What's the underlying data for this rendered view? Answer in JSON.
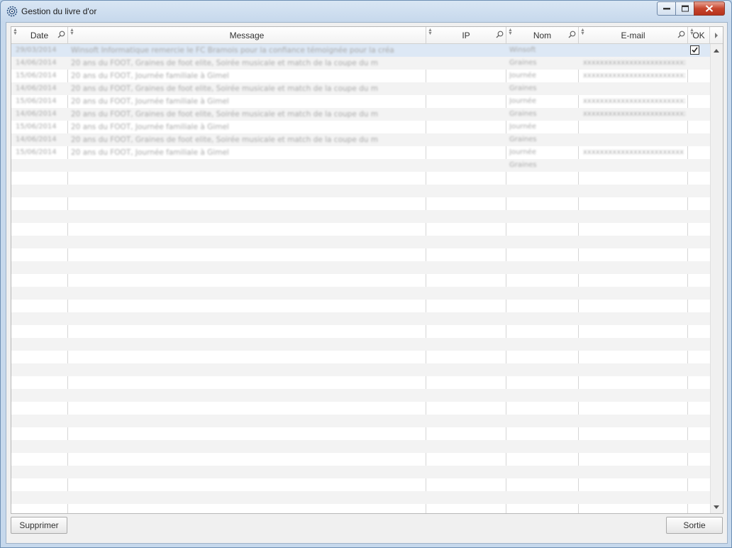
{
  "window": {
    "title": "Gestion du livre d'or",
    "icon": "gear-icon"
  },
  "grid": {
    "columns": [
      {
        "key": "date",
        "label": "Date",
        "icon": "search-icon"
      },
      {
        "key": "message",
        "label": "Message",
        "icon": null
      },
      {
        "key": "ip",
        "label": "IP",
        "icon": "search-icon"
      },
      {
        "key": "nom",
        "label": "Nom",
        "icon": "search-icon"
      },
      {
        "key": "email",
        "label": "E-mail",
        "icon": "search-icon"
      },
      {
        "key": "ok",
        "label": "OK",
        "icon": null
      }
    ],
    "rows": [
      {
        "date": "29/03/2014",
        "message": "Winsoft Informatique remercie le FC Bramois pour la confiance témoignée pour la créa",
        "ip": "",
        "nom": "Winsoft",
        "email": "",
        "ok": true,
        "selected": true
      },
      {
        "date": "14/06/2014",
        "message": "20 ans du FOOT, Graines de foot elite, Soirée musicale et match de la coupe du m",
        "ip": "",
        "nom": "Graines",
        "email": "xxxxxxxxxxxxxxxxxxxxxxxxxxxx",
        "ok": false
      },
      {
        "date": "15/06/2014",
        "message": "20 ans du FOOT, Journée familiale à Gimel",
        "ip": "",
        "nom": "Journée",
        "email": "xxxxxxxxxxxxxxxxxxxxxxxxxx",
        "ok": false
      },
      {
        "date": "14/06/2014",
        "message": "20 ans du FOOT, Graines de foot elite, Soirée musicale et match de la coupe du m",
        "ip": "",
        "nom": "Graines",
        "email": "",
        "ok": false
      },
      {
        "date": "15/06/2014",
        "message": "20 ans du FOOT, Journée familiale à Gimel",
        "ip": "",
        "nom": "Journée",
        "email": "xxxxxxxxxxxxxxxxxxxxxxxxx",
        "ok": false
      },
      {
        "date": "14/06/2014",
        "message": "20 ans du FOOT, Graines de foot elite, Soirée musicale et match de la coupe du m",
        "ip": "",
        "nom": "Graines",
        "email": "xxxxxxxxxxxxxxxxxxxxxxxxxxx",
        "ok": false
      },
      {
        "date": "15/06/2014",
        "message": "20 ans du FOOT, Journée familiale à Gimel",
        "ip": "",
        "nom": "Journée",
        "email": "",
        "ok": false
      },
      {
        "date": "14/06/2014",
        "message": "20 ans du FOOT, Graines de foot elite, Soirée musicale et match de la coupe du m",
        "ip": "",
        "nom": "Graines",
        "email": "",
        "ok": false
      },
      {
        "date": "15/06/2014",
        "message": "20 ans du FOOT, Journée familiale à Gimel",
        "ip": "",
        "nom": "Journée",
        "email": "xxxxxxxxxxxxxxxxxxxxxxxx",
        "ok": false
      },
      {
        "date": "",
        "message": "",
        "ip": "",
        "nom": "Graines",
        "email": "",
        "ok": false
      }
    ]
  },
  "buttons": {
    "delete_label": "Supprimer",
    "exit_label": "Sortie"
  },
  "colors": {
    "selected_row": "#dde8f5",
    "alt_row": "#f3f3f3"
  }
}
